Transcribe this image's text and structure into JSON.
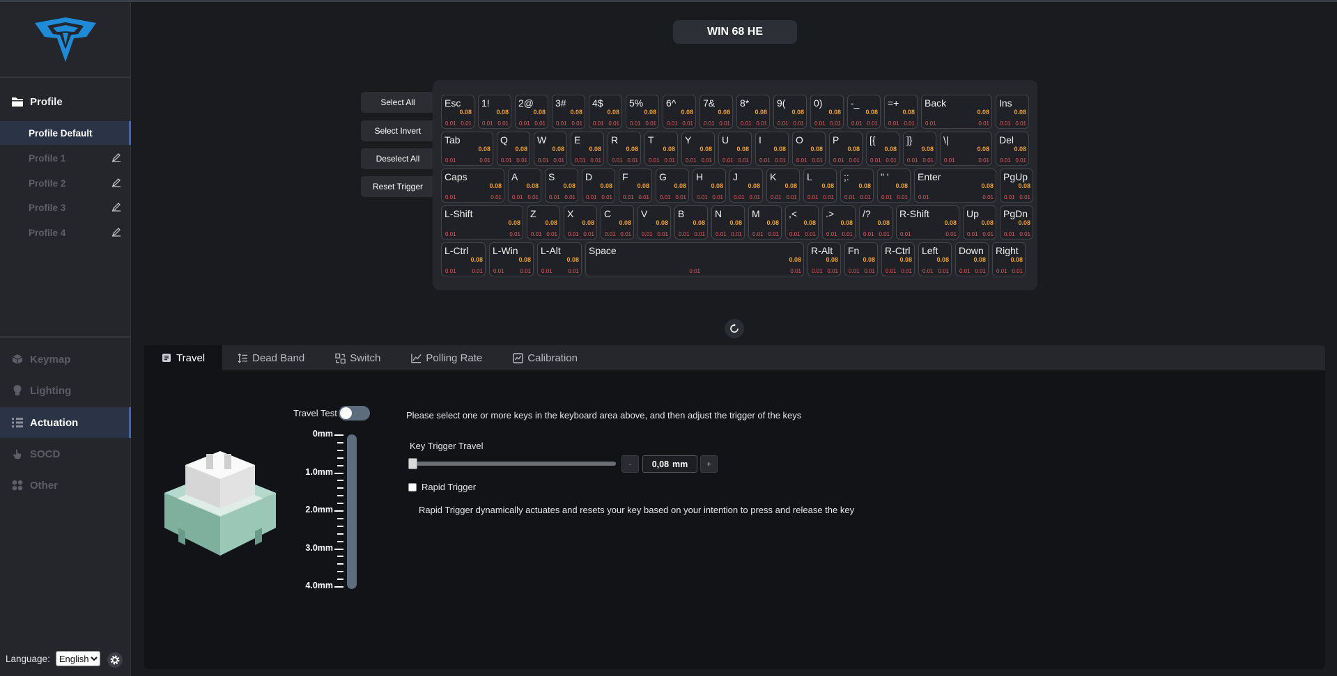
{
  "header": {
    "model_name": "WIN 68 HE"
  },
  "sidebar": {
    "profile_title": "Profile",
    "profiles": [
      {
        "label": "Profile Default",
        "active": true
      },
      {
        "label": "Profile 1"
      },
      {
        "label": "Profile 2"
      },
      {
        "label": "Profile 3"
      },
      {
        "label": "Profile 4"
      }
    ],
    "nav": [
      {
        "label": "Keymap",
        "icon": "cube-icon"
      },
      {
        "label": "Lighting",
        "icon": "bulb-icon"
      },
      {
        "label": "Actuation",
        "icon": "grid-icon",
        "active": true
      },
      {
        "label": "SOCD",
        "icon": "hand-icon"
      },
      {
        "label": "Other",
        "icon": "apps-icon"
      }
    ],
    "language_label": "Language:",
    "language_value": "English"
  },
  "actions": {
    "select_all": "Select All",
    "select_invert": "Select Invert",
    "deselect_all": "Deselect All",
    "reset_trigger": "Reset Trigger"
  },
  "keyboard": {
    "rows": [
      [
        [
          "Esc",
          "0.08",
          "0.01",
          "0.01"
        ],
        [
          "1!",
          "0.08",
          "0.01",
          "0.01"
        ],
        [
          "2@",
          "0.08",
          "0.01",
          "0.01"
        ],
        [
          "3#",
          "0.08",
          "0.01",
          "0.01"
        ],
        [
          "4$",
          "0.08",
          "0.01",
          "0.01"
        ],
        [
          "5%",
          "0.08",
          "0.01",
          "0.01"
        ],
        [
          "6^",
          "0.08",
          "0.01",
          "0.01"
        ],
        [
          "7&",
          "0.08",
          "0.01",
          "0.01"
        ],
        [
          "8*",
          "0.08",
          "0.01",
          "0.01"
        ],
        [
          "9(",
          "0.08",
          "0.01",
          "0.01"
        ],
        [
          "0)",
          "0.08",
          "0.01",
          "0.01"
        ],
        [
          "-_",
          "0.08",
          "0.01",
          "0.01"
        ],
        [
          "=+",
          "0.08",
          "0.01",
          "0.01"
        ],
        [
          "Back",
          "0.08",
          "0.01",
          "0.01"
        ],
        [
          "Ins",
          "0.08",
          "0.01",
          "0.01"
        ]
      ],
      [
        [
          "Tab",
          "0.08",
          "0.01",
          "0.01"
        ],
        [
          "Q",
          "0.08",
          "0.01",
          "0.01"
        ],
        [
          "W",
          "0.08",
          "0.01",
          "0.01"
        ],
        [
          "E",
          "0.08",
          "0.01",
          "0.01"
        ],
        [
          "R",
          "0.08",
          "0.01",
          "0.01"
        ],
        [
          "T",
          "0.08",
          "0.01",
          "0.01"
        ],
        [
          "Y",
          "0.08",
          "0.01",
          "0.01"
        ],
        [
          "U",
          "0.08",
          "0.01",
          "0.01"
        ],
        [
          "I",
          "0.08",
          "0.01",
          "0.01"
        ],
        [
          "O",
          "0.08",
          "0.01",
          "0.01"
        ],
        [
          "P",
          "0.08",
          "0.01",
          "0.01"
        ],
        [
          "[{",
          "0.08",
          "0.01",
          "0.01"
        ],
        [
          "]}",
          "0.08",
          "0.01",
          "0.01"
        ],
        [
          "\\|",
          "0.08",
          "0.01",
          "0.01"
        ],
        [
          "Del",
          "0.08",
          "0.01",
          "0.01"
        ]
      ],
      [
        [
          "Caps",
          "0.08",
          "0.01",
          "0.01"
        ],
        [
          "A",
          "0.08",
          "0.01",
          "0.01"
        ],
        [
          "S",
          "0.08",
          "0.01",
          "0.01"
        ],
        [
          "D",
          "0.08",
          "0.01",
          "0.01"
        ],
        [
          "F",
          "0.08",
          "0.01",
          "0.01"
        ],
        [
          "G",
          "0.08",
          "0.01",
          "0.01"
        ],
        [
          "H",
          "0.08",
          "0.01",
          "0.01"
        ],
        [
          "J",
          "0.08",
          "0.01",
          "0.01"
        ],
        [
          "K",
          "0.08",
          "0.01",
          "0.01"
        ],
        [
          "L",
          "0.08",
          "0.01",
          "0.01"
        ],
        [
          ";:",
          "0.08",
          "0.01",
          "0.01"
        ],
        [
          "\" '",
          "0.08",
          "0.01",
          "0.01"
        ],
        [
          "Enter",
          "0.08",
          "0.01",
          "0.01"
        ],
        [
          "PgUp",
          "0.08",
          "0.01",
          "0.01"
        ]
      ],
      [
        [
          "L-Shift",
          "0.08",
          "0.01",
          "0.01"
        ],
        [
          "Z",
          "0.08",
          "0.01",
          "0.01"
        ],
        [
          "X",
          "0.08",
          "0.01",
          "0.01"
        ],
        [
          "C",
          "0.08",
          "0.01",
          "0.01"
        ],
        [
          "V",
          "0.08",
          "0.01",
          "0.01"
        ],
        [
          "B",
          "0.08",
          "0.01",
          "0.01"
        ],
        [
          "N",
          "0.08",
          "0.01",
          "0.01"
        ],
        [
          "M",
          "0.08",
          "0.01",
          "0.01"
        ],
        [
          ",<",
          "0.08",
          "0.01",
          "0.01"
        ],
        [
          ".>",
          "0.08",
          "0.01",
          "0.01"
        ],
        [
          "/?",
          "0.08",
          "0.01",
          "0.01"
        ],
        [
          "R-Shift",
          "0.08",
          "0.01",
          "0.01"
        ],
        [
          "Up",
          "0.08",
          "0.01",
          "0.01"
        ],
        [
          "PgDn",
          "0.08",
          "0.01",
          "0.01"
        ]
      ],
      [
        [
          "L-Ctrl",
          "0.08",
          "0.01",
          "0.01"
        ],
        [
          "L-Win",
          "0.08",
          "0.01",
          "0.01"
        ],
        [
          "L-Alt",
          "0.08",
          "0.01",
          "0.01"
        ],
        [
          "Space",
          "0.08",
          "0.01",
          "0.01"
        ],
        [
          "R-Alt",
          "0.08",
          "0.01",
          "0.01"
        ],
        [
          "Fn",
          "0.08",
          "0.01",
          "0.01"
        ],
        [
          "R-Ctrl",
          "0.08",
          "0.01",
          "0.01"
        ],
        [
          "Left",
          "0.08",
          "0.01",
          "0.01"
        ],
        [
          "Down",
          "0.08",
          "0.01",
          "0.01"
        ],
        [
          "Right",
          "0.08",
          "0.01",
          "0.01"
        ]
      ]
    ]
  },
  "tabs": [
    {
      "label": "Travel",
      "icon": "document-icon",
      "active": true
    },
    {
      "label": "Dead Band",
      "icon": "list-icon"
    },
    {
      "label": "Switch",
      "icon": "switch-icon"
    },
    {
      "label": "Polling Rate",
      "icon": "line-chart-icon"
    },
    {
      "label": "Calibration",
      "icon": "chart-box-icon"
    }
  ],
  "travel": {
    "travel_test_label": "Travel Test",
    "travel_test_on": false,
    "scale_labels": [
      "0mm",
      "1.0mm",
      "2.0mm",
      "3.0mm",
      "4.0mm"
    ],
    "hint": "Please select one or more keys in the keyboard area above, and then adjust the trigger of the keys",
    "key_trigger_label": "Key Trigger Travel",
    "decrement": "-",
    "increment": "+",
    "value": "0,08",
    "unit": "mm",
    "slider_fraction": 0.0,
    "rapid_trigger_label": "Rapid Trigger",
    "rapid_trigger_checked": false,
    "rapid_trigger_desc": "Rapid Trigger dynamically actuates and resets your key based on your intention to press and release the key"
  },
  "colors": {
    "accent": "#3a66c8",
    "trigger_value": "#f0a030",
    "rt_value": "#e35a5a",
    "logo": "#1f8ad6"
  }
}
